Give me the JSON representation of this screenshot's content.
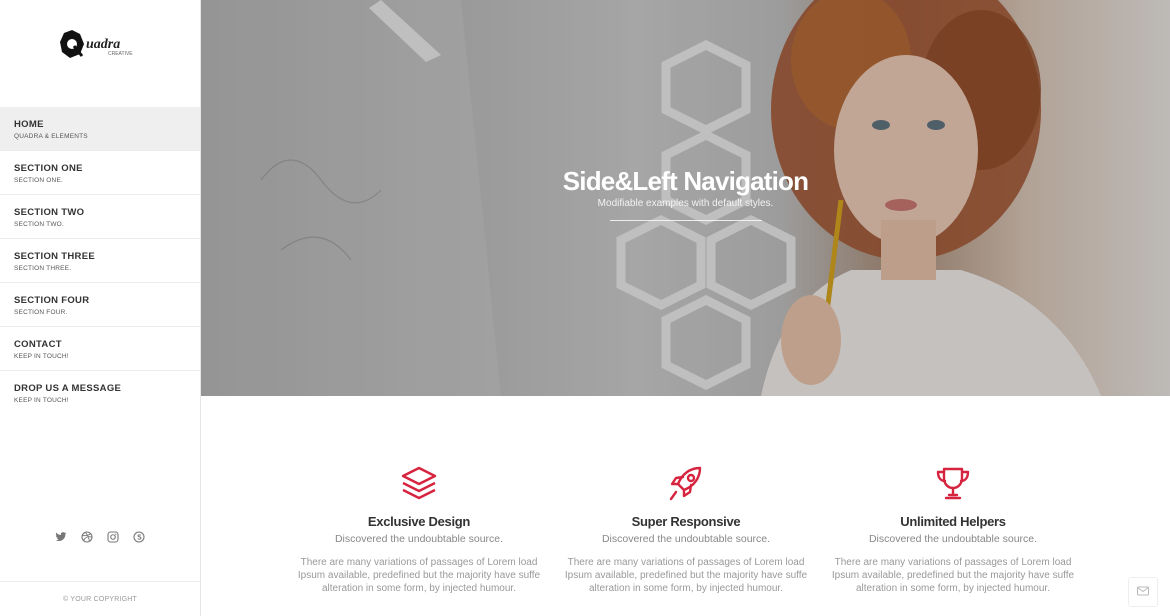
{
  "sidebar": {
    "logo": {
      "text": "uadra",
      "subtext": "CREATIVE"
    },
    "items": [
      {
        "title": "HOME",
        "sub": "QUADRA & ELEMENTS"
      },
      {
        "title": "SECTION ONE",
        "sub": "SECTION ONE."
      },
      {
        "title": "SECTION TWO",
        "sub": "SECTION TWO."
      },
      {
        "title": "SECTION THREE",
        "sub": "SECTION THREE."
      },
      {
        "title": "SECTION FOUR",
        "sub": "SECTION FOUR."
      },
      {
        "title": "CONTACT",
        "sub": "KEEP IN TOUCH!"
      },
      {
        "title": "DROP US A MESSAGE",
        "sub": "KEEP IN TOUCH!"
      }
    ],
    "socials": [
      "twitter-icon",
      "dribbble-icon",
      "instagram-icon",
      "skype-icon"
    ],
    "copyright": "© YOUR COPYRIGHT"
  },
  "hero": {
    "title": "Side&Left Navigation",
    "subtitle": "Modifiable examples with default styles."
  },
  "features": [
    {
      "icon": "layers-icon",
      "title": "Exclusive Design",
      "subtitle": "Discovered the undoubtable source.",
      "desc": "There are many variations of passages of Lorem load Ipsum available, predefined but the majority have suffe alteration in some form, by injected humour."
    },
    {
      "icon": "rocket-icon",
      "title": "Super Responsive",
      "subtitle": "Discovered the undoubtable source.",
      "desc": "There are many variations of passages of Lorem load Ipsum available, predefined but the majority have suffe alteration in some form, by injected humour."
    },
    {
      "icon": "trophy-icon",
      "title": "Unlimited Helpers",
      "subtitle": "Discovered the undoubtable source.",
      "desc": "There are many variations of passages of Lorem load Ipsum available, predefined but the majority have suffe alteration in some form, by injected humour."
    }
  ],
  "colors": {
    "accent": "#d6243f",
    "text": "#333333",
    "muted": "#999999"
  }
}
